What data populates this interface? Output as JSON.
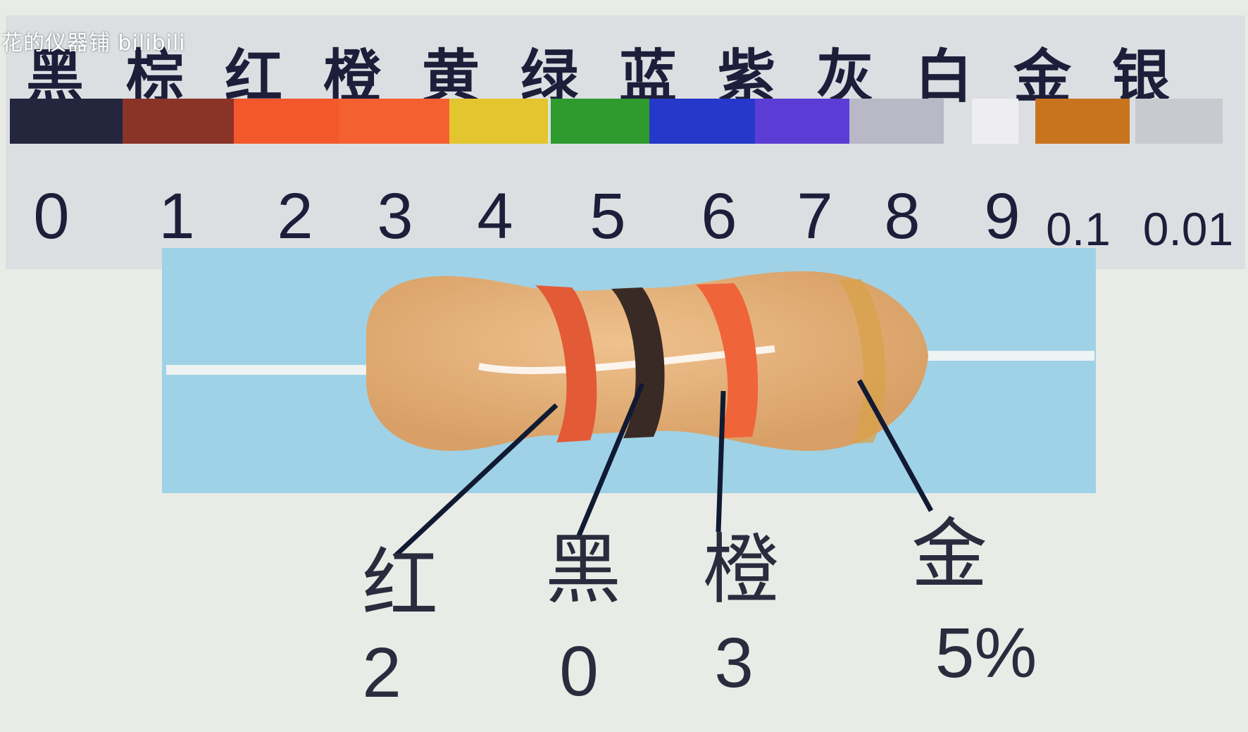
{
  "watermark": "花的仪器铺 bilibili",
  "color_code_table": [
    {
      "name": "黑",
      "digit": "0",
      "color": "#24263d"
    },
    {
      "name": "棕",
      "digit": "1",
      "color": "#8a3327"
    },
    {
      "name": "红",
      "digit": "2",
      "color": "#f2582c"
    },
    {
      "name": "橙",
      "digit": "3",
      "color": "#f4602f"
    },
    {
      "name": "黄",
      "digit": "4",
      "color": "#e3c530"
    },
    {
      "name": "绿",
      "digit": "5",
      "color": "#2f9a2e"
    },
    {
      "name": "蓝",
      "digit": "6",
      "color": "#2638c9"
    },
    {
      "name": "紫",
      "digit": "7",
      "color": "#5b3dd6"
    },
    {
      "name": "灰",
      "digit": "8",
      "color": "#b8b8c6"
    },
    {
      "name": "白",
      "digit": "9",
      "color": "#eeeef0"
    },
    {
      "name": "金",
      "digit": "0.1",
      "color": "#c8741e"
    },
    {
      "name": "银",
      "digit": "0.01",
      "color": "#c9c9d0"
    }
  ],
  "resistor_example": {
    "bands": [
      {
        "name": "红",
        "value": "2",
        "color": "#e35a36"
      },
      {
        "name": "黑",
        "value": "0",
        "color": "#3a2a26"
      },
      {
        "name": "橙",
        "value": "3",
        "color": "#f0643a"
      },
      {
        "name": "金",
        "value": "5%",
        "color": "#d7a14a"
      }
    ]
  },
  "colors": {
    "background": "#e9ece6",
    "chart_background": "#dcdfe2",
    "photo_sky": "#9fd2e6",
    "resistor_body": "#e3b07a",
    "text": "#1d1e3a",
    "leader_line": "#111a33"
  }
}
